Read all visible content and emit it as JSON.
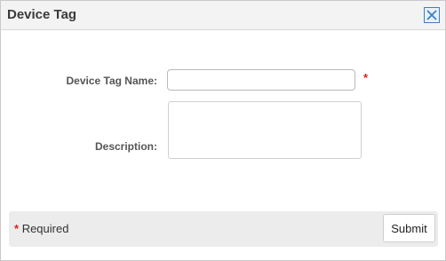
{
  "dialog": {
    "title": "Device Tag",
    "close_icon": "close-x-icon"
  },
  "form": {
    "name_label": "Device Tag Name:",
    "name_value": "",
    "name_placeholder": "",
    "required_marker": "*",
    "description_label": "Description:",
    "description_value": "",
    "description_placeholder": ""
  },
  "footer": {
    "required_marker": "*",
    "required_text": "Required",
    "submit_label": "Submit"
  },
  "colors": {
    "required_red": "#dd2222",
    "close_blue": "#3b7fc4"
  }
}
